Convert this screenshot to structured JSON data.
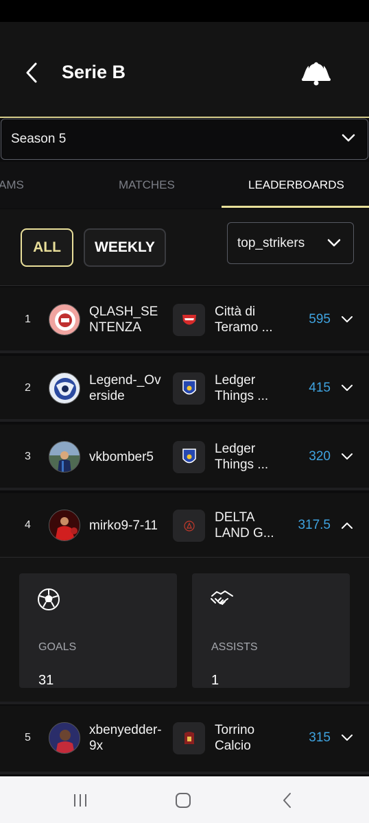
{
  "header": {
    "title": "Serie B"
  },
  "season_select": {
    "value": "Season 5"
  },
  "tabs": [
    {
      "label": "AMS"
    },
    {
      "label": "MATCHES"
    },
    {
      "label": "LEADERBOARDS"
    }
  ],
  "filters": {
    "all_label": "ALL",
    "weekly_label": "WEEKLY",
    "category": "top_strikers"
  },
  "rows": [
    {
      "rank": "1",
      "player": "QLASH_SENTENZA",
      "club": "Città di Teramo ...",
      "score": "595"
    },
    {
      "rank": "2",
      "player": "Legend-_Overside",
      "club": "Ledger Things ...",
      "score": "415"
    },
    {
      "rank": "3",
      "player": "vkbomber5",
      "club": "Ledger Things ...",
      "score": "320"
    },
    {
      "rank": "4",
      "player": "mirko9-7-11",
      "club": "DELTA LAND G...",
      "score": "317.5"
    },
    {
      "rank": "5",
      "player": "xbenyedder-9x",
      "club": "Torrino Calcio",
      "score": "315"
    }
  ],
  "expanded_stats": {
    "goals_label": "GOALS",
    "goals_value": "31",
    "assists_label": "ASSISTS",
    "assists_value": "1"
  },
  "colors": {
    "accent": "#e9df9a",
    "score": "#3fa3e0",
    "background": "#0c0c0d"
  }
}
